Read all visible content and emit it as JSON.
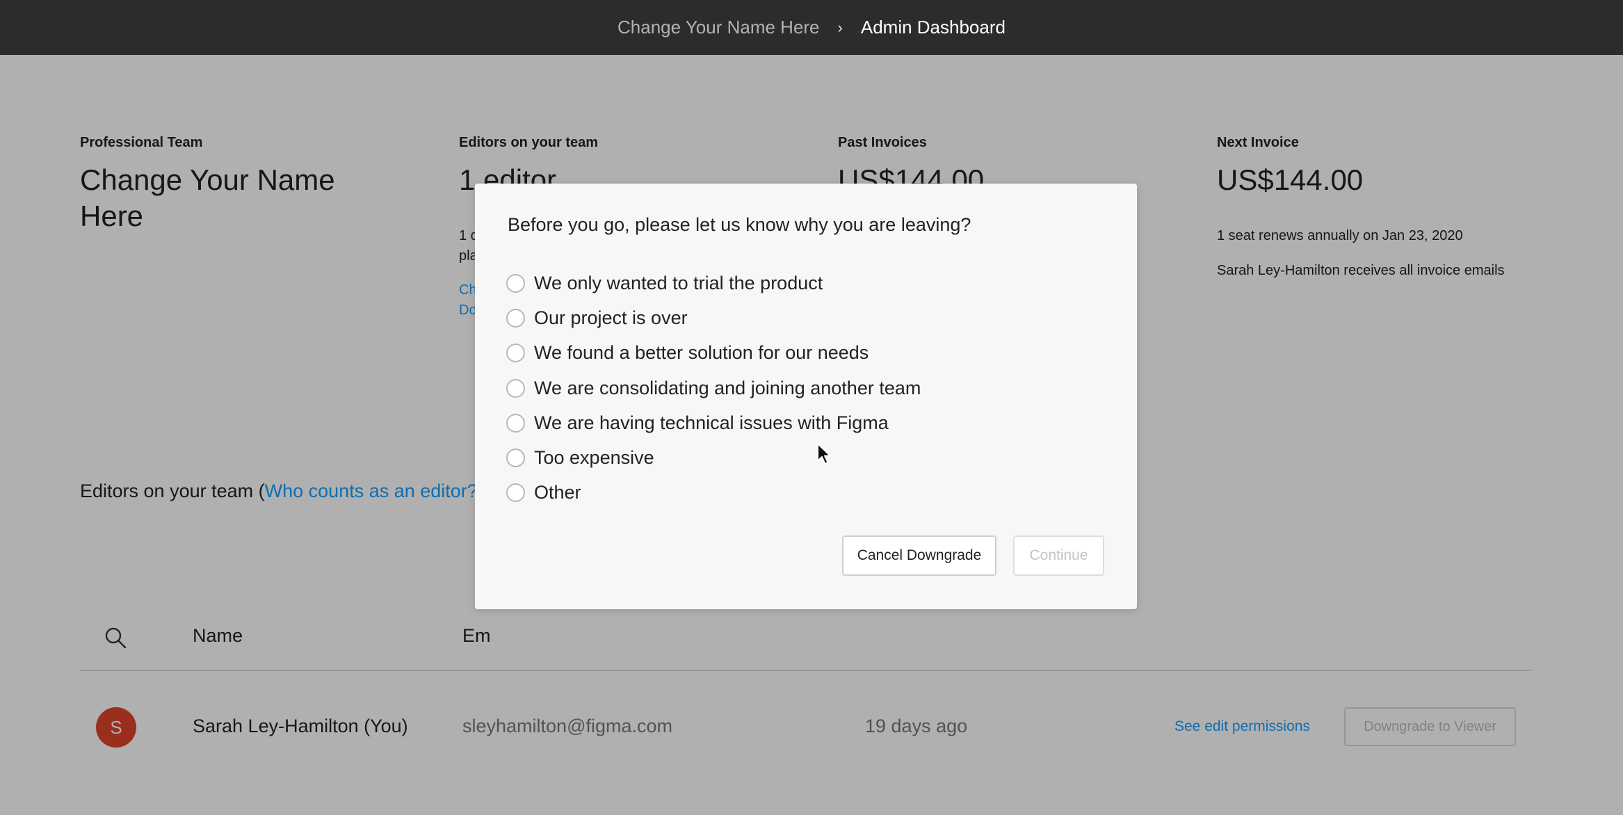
{
  "breadcrumb": {
    "team": "Change Your Name Here",
    "separator": "›",
    "page": "Admin Dashboard"
  },
  "stats": {
    "plan": {
      "label": "Professional Team",
      "value": "Change Your Name Here"
    },
    "editors": {
      "label": "Editors on your team",
      "value": "1 editor",
      "note_line1": "1 c",
      "note_line2": "pla",
      "link_line1": "Ch",
      "link_line2": "Do"
    },
    "past_invoices": {
      "label": "Past Invoices",
      "value": "US$144.00"
    },
    "next_invoice": {
      "label": "Next Invoice",
      "value": "US$144.00",
      "renewal": "1 seat renews annually on Jan 23, 2020",
      "emails": "Sarah Ley-Hamilton receives all invoice emails"
    }
  },
  "editors_section": {
    "heading_prefix": "Editors on your team (",
    "heading_link": "Who counts as an editor?"
  },
  "table": {
    "columns": {
      "name": "Name",
      "email": "Em"
    },
    "rows": [
      {
        "avatar_initial": "S",
        "name": "Sarah Ley-Hamilton (You)",
        "email": "sleyhamilton@figma.com",
        "date": "19 days ago",
        "permissions_link": "See edit permissions",
        "downgrade_label": "Downgrade to Viewer"
      }
    ]
  },
  "modal": {
    "title": "Before you go, please let us know why you are leaving?",
    "options": [
      "We only wanted to trial the product",
      "Our project is over",
      "We found a better solution for our needs",
      "We are consolidating and joining another team",
      "We are having technical issues with Figma",
      "Too expensive",
      "Other"
    ],
    "cancel_label": "Cancel Downgrade",
    "continue_label": "Continue"
  },
  "colors": {
    "topbar": "#2c2c2c",
    "link": "#18a0fb",
    "avatar": "#e0432e",
    "modal_bg": "#f7f7f7"
  }
}
